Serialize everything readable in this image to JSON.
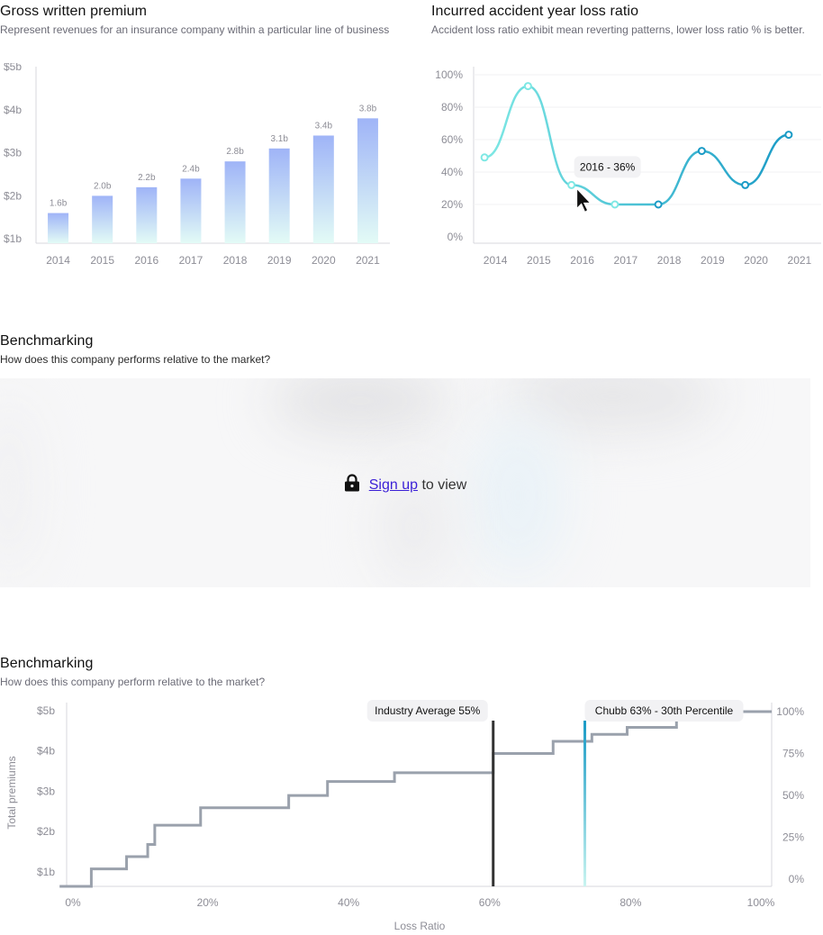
{
  "gwp": {
    "title": "Gross written premium",
    "subtitle": "Represent revenues for an insurance company within a particular line of business"
  },
  "loss": {
    "title": "Incurred accident year loss ratio",
    "subtitle": "Accident loss ratio exhibit mean reverting patterns, lower loss ratio % is better.",
    "tooltip": "2016 - 36%"
  },
  "bench_locked": {
    "title": "Benchmarking",
    "subtitle": "How does this company performs relative to the market?",
    "signup_label": "Sign up",
    "suffix": " to view"
  },
  "bench": {
    "title": "Benchmarking",
    "subtitle": "How does this company perform relative to the market?"
  },
  "colors": {
    "bar_top": "#9fb4f7",
    "bar_bottom": "#e3fbf6",
    "line_start": "#7ee8e4",
    "line_end": "#1a9bc6",
    "step": "#9aa1ac",
    "industry": "#333333",
    "company": "#1a9bc6"
  },
  "chart_data": [
    {
      "type": "bar",
      "categories": [
        "2014",
        "2015",
        "2016",
        "2017",
        "2018",
        "2019",
        "2020",
        "2021"
      ],
      "values": [
        1.6,
        2.0,
        2.2,
        2.4,
        2.8,
        3.1,
        3.4,
        3.8
      ],
      "data_labels": [
        "1.6b",
        "2.0b",
        "2.2b",
        "2.4b",
        "2.8b",
        "3.1b",
        "3.4b",
        "3.8b"
      ],
      "y_ticks": [
        "$1b",
        "$2b",
        "$3b",
        "$4b",
        "$5b"
      ],
      "ylim": [
        0.9,
        5.0
      ]
    },
    {
      "type": "line",
      "categories": [
        "2014",
        "2015",
        "2016",
        "2017",
        "2018",
        "2019",
        "2020",
        "2021"
      ],
      "values": [
        49,
        93,
        32,
        20,
        20,
        53,
        32,
        63
      ],
      "y_ticks": [
        "0%",
        "20%",
        "40%",
        "60%",
        "80%",
        "100%"
      ],
      "ylim": [
        0,
        100
      ],
      "grid": true
    },
    {
      "type": "line",
      "xlabel": "Loss Ratio",
      "ylabel": "Total premiums",
      "x_ticks": [
        "0%",
        "20%",
        "40%",
        "60%",
        "80%",
        "100%"
      ],
      "y_ticks_left": [
        "$1b",
        "$2b",
        "$3b",
        "$4b",
        "$5b"
      ],
      "y_ticks_right": [
        "0%",
        "25%",
        "50%",
        "75%",
        "100%"
      ],
      "xlim": [
        0,
        100
      ],
      "ylim_right": [
        0,
        100
      ],
      "cumulative_steps": [
        [
          -1,
          0
        ],
        [
          3.5,
          0
        ],
        [
          3.5,
          10
        ],
        [
          8.5,
          10
        ],
        [
          8.5,
          17
        ],
        [
          11.5,
          17
        ],
        [
          11.5,
          24
        ],
        [
          12.5,
          24
        ],
        [
          12.5,
          35
        ],
        [
          19,
          35
        ],
        [
          19,
          45
        ],
        [
          31.5,
          45
        ],
        [
          31.5,
          52
        ],
        [
          37,
          52
        ],
        [
          37,
          60
        ],
        [
          46.5,
          60
        ],
        [
          46.5,
          65
        ],
        [
          60.5,
          65
        ],
        [
          60.5,
          76
        ],
        [
          69,
          76
        ],
        [
          69,
          83
        ],
        [
          74.5,
          83
        ],
        [
          74.5,
          87
        ],
        [
          79.5,
          87
        ],
        [
          79.5,
          91
        ],
        [
          86.5,
          91
        ],
        [
          86.5,
          100
        ],
        [
          100,
          100
        ]
      ],
      "markers": [
        {
          "label": "Industry Average 55%",
          "x": 60.5
        },
        {
          "label": "Chubb 63% - 30th Percentile",
          "x": 73.5
        }
      ]
    }
  ]
}
